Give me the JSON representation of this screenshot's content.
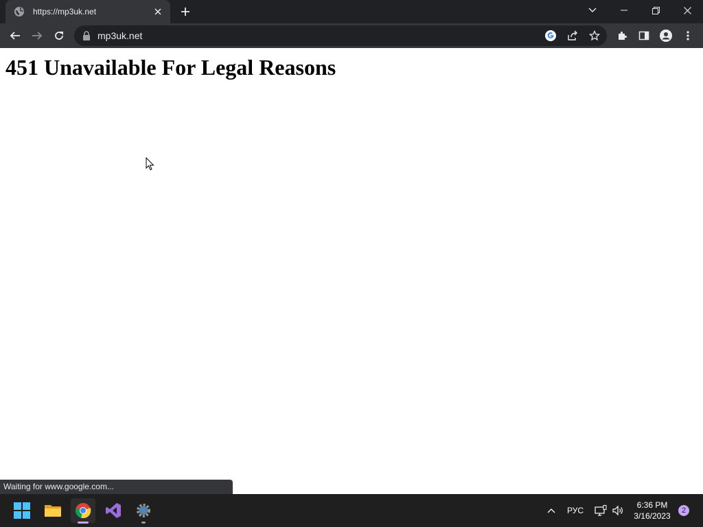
{
  "browser": {
    "tab": {
      "title": "https://mp3uk.net"
    },
    "omnibox": {
      "url": "mp3uk.net"
    },
    "status_text": "Waiting for www.google.com..."
  },
  "page": {
    "heading": "451 Unavailable For Legal Reasons"
  },
  "taskbar": {
    "apps": [
      "start-menu",
      "file-explorer",
      "google-chrome",
      "visual-studio",
      "settings"
    ],
    "tray": {
      "language": "РУС",
      "time": "6:36 PM",
      "date": "3/16/2023",
      "notification_count": "2"
    }
  },
  "colors": {
    "tab_bar": "#202124",
    "toolbar": "#35363a",
    "taskbar": "#1f1f1f",
    "chrome_indicator": "#c9a1ff"
  }
}
